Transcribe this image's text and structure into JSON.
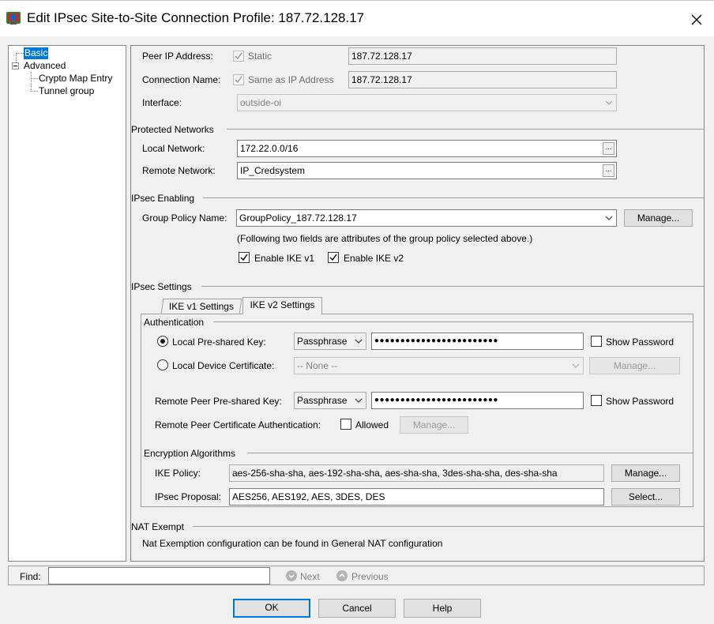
{
  "window": {
    "title": "Edit IPsec Site-to-Site Connection Profile: 187.72.128.17",
    "close_glyph": "✕"
  },
  "tree": {
    "items": [
      {
        "label": "Basic",
        "selected": true
      },
      {
        "label": "Advanced",
        "expanded": true
      },
      {
        "label": "Crypto Map Entry"
      },
      {
        "label": "Tunnel group"
      }
    ]
  },
  "basic": {
    "peer_ip": {
      "label": "Peer IP Address:",
      "check_label": "Static",
      "value": "187.72.128.17"
    },
    "conn_name": {
      "label": "Connection Name:",
      "check_label": "Same as IP Address",
      "value": "187.72.128.17"
    },
    "interface": {
      "label": "Interface:",
      "value": "outside-oi"
    }
  },
  "protected_networks": {
    "heading": "Protected Networks",
    "local": {
      "label": "Local Network:",
      "value": "172.22.0.0/16"
    },
    "remote": {
      "label": "Remote Network:",
      "value": "IP_Credsystem"
    },
    "ellipsis": "..."
  },
  "ipsec_enabling": {
    "heading": "IPsec Enabling",
    "group_policy": {
      "label": "Group Policy Name:",
      "value": "GroupPolicy_187.72.128.17",
      "manage": "Manage..."
    },
    "note": "(Following two fields are attributes of the group policy selected above.)",
    "ike_v1": {
      "label": "Enable IKE v1",
      "checked": true
    },
    "ike_v2": {
      "label": "Enable IKE v2",
      "checked": true
    }
  },
  "ipsec_settings": {
    "heading": "IPsec Settings",
    "tabs": [
      {
        "label": "IKE v1 Settings",
        "active": false
      },
      {
        "label": "IKE v2 Settings",
        "active": true
      }
    ],
    "authentication": {
      "heading": "Authentication",
      "local_psk": {
        "label": "Local Pre-shared Key:",
        "type": "Passphrase",
        "value": "●●●●●●●●●●●●●●●●●●●●●●●●",
        "show": "Show Password"
      },
      "local_cert": {
        "label": "Local Device Certificate:",
        "value": "-- None --",
        "manage": "Manage..."
      },
      "remote_psk": {
        "label": "Remote Peer Pre-shared Key:",
        "type": "Passphrase",
        "value": "●●●●●●●●●●●●●●●●●●●●●●●●",
        "show": "Show Password"
      },
      "remote_cert": {
        "label": "Remote Peer Certificate Authentication:",
        "allowed": "Allowed",
        "manage": "Manage..."
      }
    },
    "encryption": {
      "heading": "Encryption Algorithms",
      "ike_policy": {
        "label": "IKE Policy:",
        "value": "aes-256-sha-sha, aes-192-sha-sha, aes-sha-sha, 3des-sha-sha, des-sha-sha",
        "button": "Manage..."
      },
      "ipsec_proposal": {
        "label": "IPsec Proposal:",
        "value": "AES256, AES192, AES, 3DES, DES",
        "button": "Select..."
      }
    }
  },
  "nat": {
    "heading": "NAT Exempt",
    "text": "Nat Exemption configuration can be found in General NAT configuration"
  },
  "find": {
    "label": "Find:",
    "value": "",
    "next": "Next",
    "previous": "Previous"
  },
  "footer": {
    "ok": "OK",
    "cancel": "Cancel",
    "help": "Help"
  },
  "colors": {
    "selection": "#0078d7",
    "background": "#f0f0f0"
  }
}
